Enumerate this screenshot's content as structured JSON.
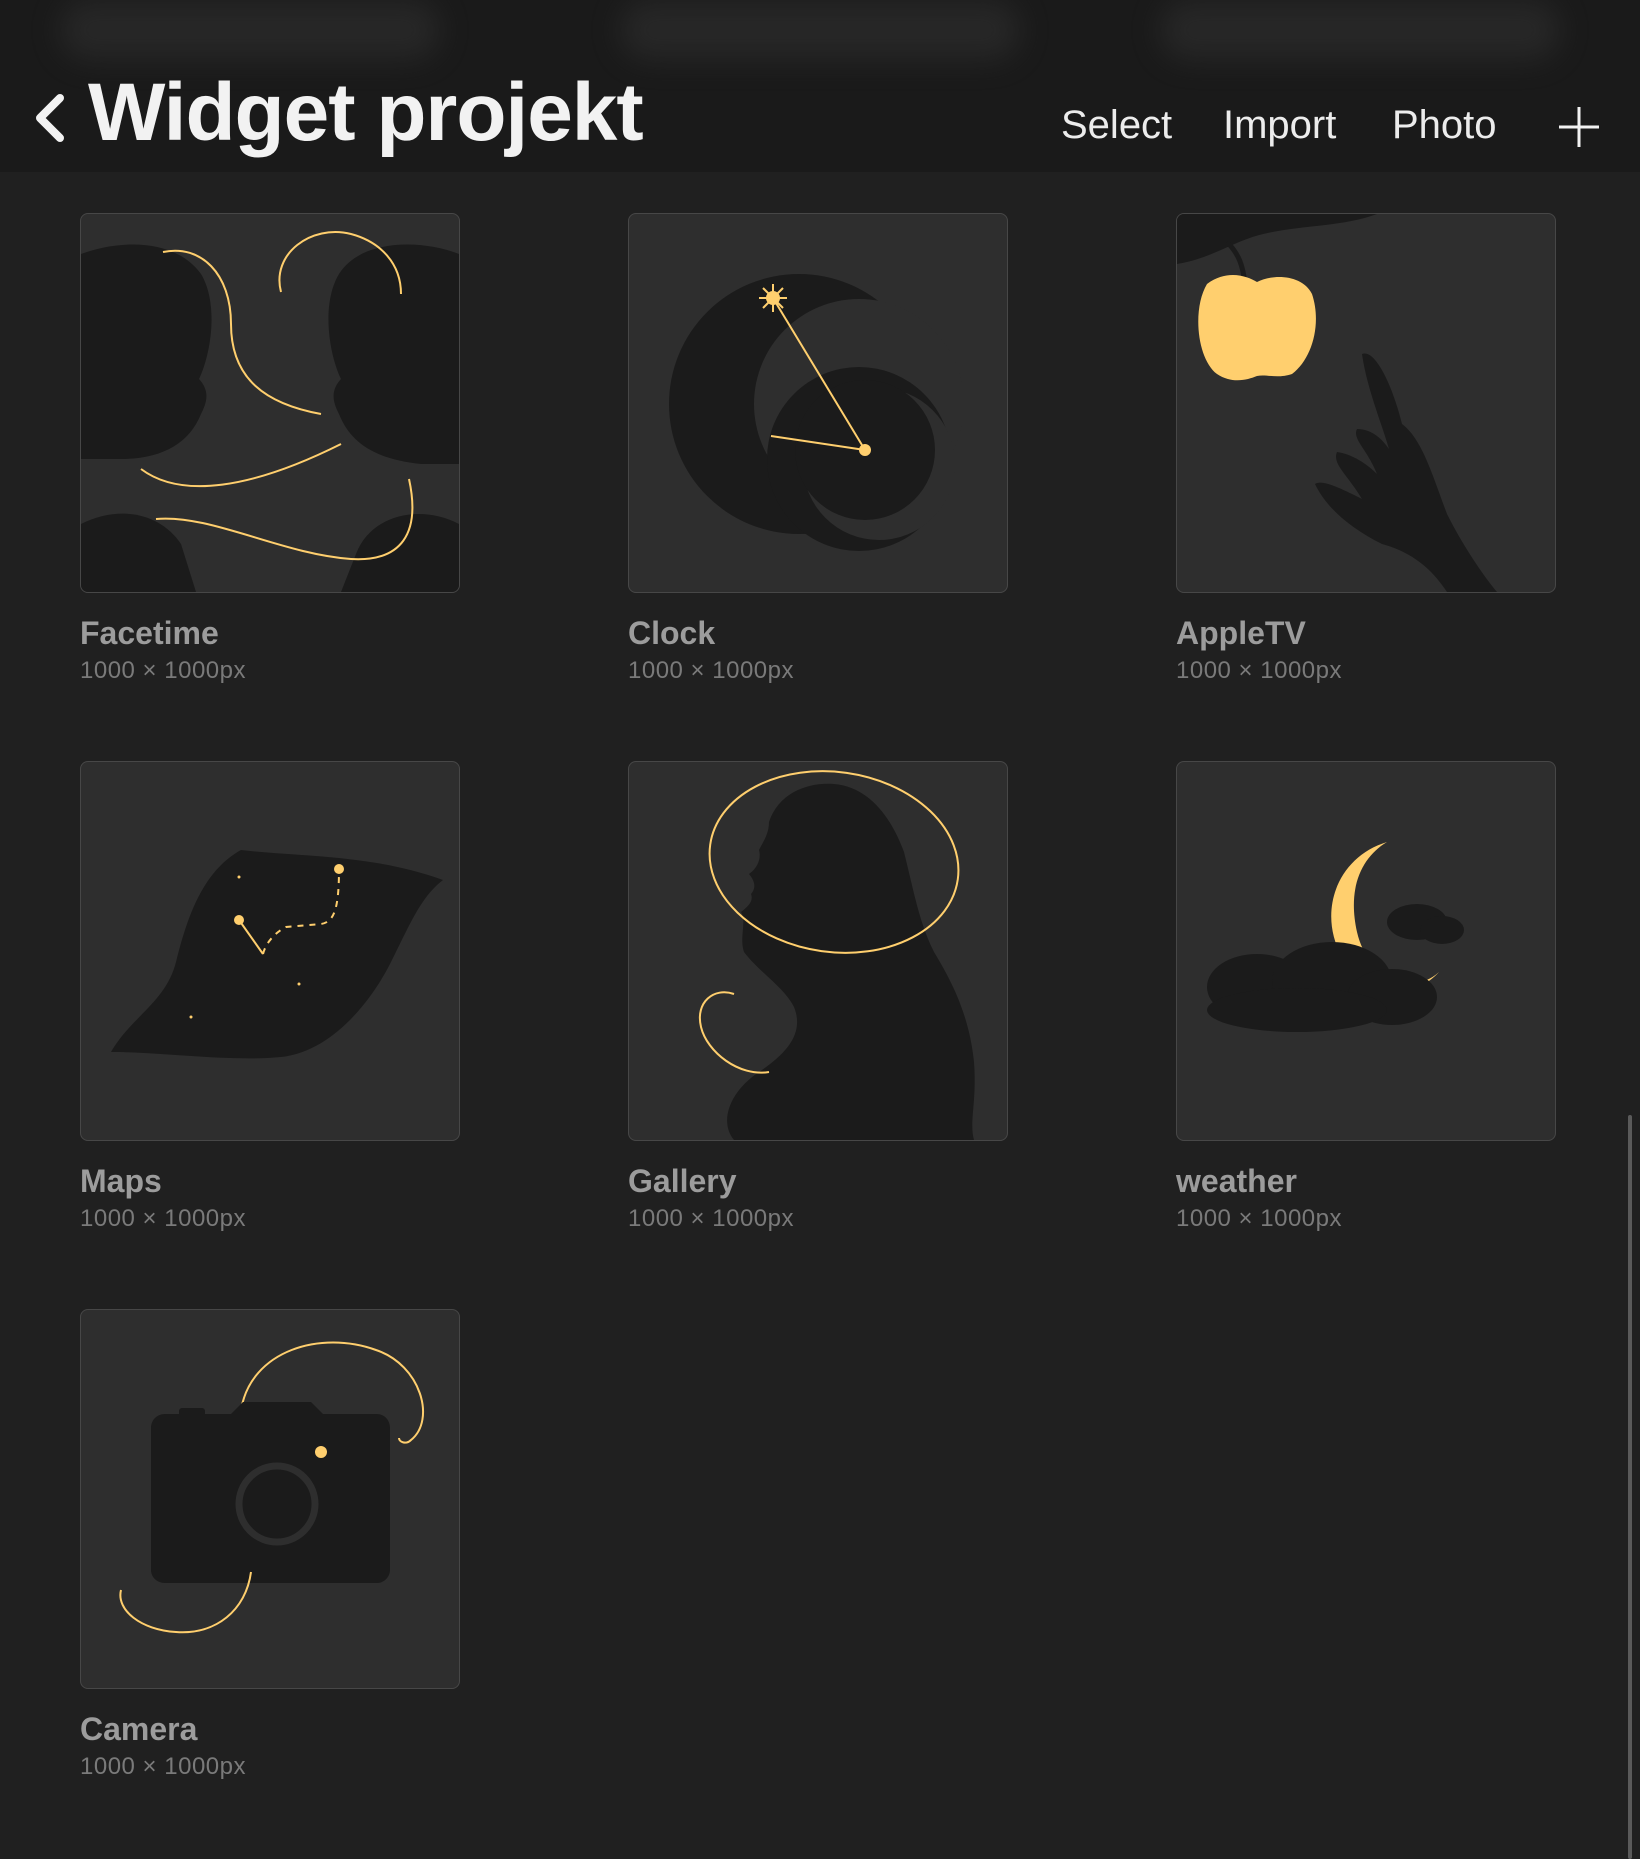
{
  "header": {
    "title": "Widget projekt",
    "back_icon": "chevron-left-icon",
    "actions": {
      "select": "Select",
      "import": "Import",
      "photo": "Photo"
    },
    "add_icon": "plus-icon"
  },
  "colors": {
    "background": "#202020",
    "header": "#1a1a1a",
    "thumbnail": "#2e2e2e",
    "silhouette": "#1b1b1b",
    "accent": "#ffcf6e"
  },
  "artworks": [
    {
      "name": "Facetime",
      "size": "1000 × 1000px"
    },
    {
      "name": "Clock",
      "size": "1000 × 1000px"
    },
    {
      "name": "AppleTV",
      "size": "1000 × 1000px"
    },
    {
      "name": "Maps",
      "size": "1000 × 1000px"
    },
    {
      "name": "Gallery",
      "size": "1000 × 1000px"
    },
    {
      "name": "weather",
      "size": "1000 × 1000px"
    },
    {
      "name": "Camera",
      "size": "1000 × 1000px"
    }
  ]
}
